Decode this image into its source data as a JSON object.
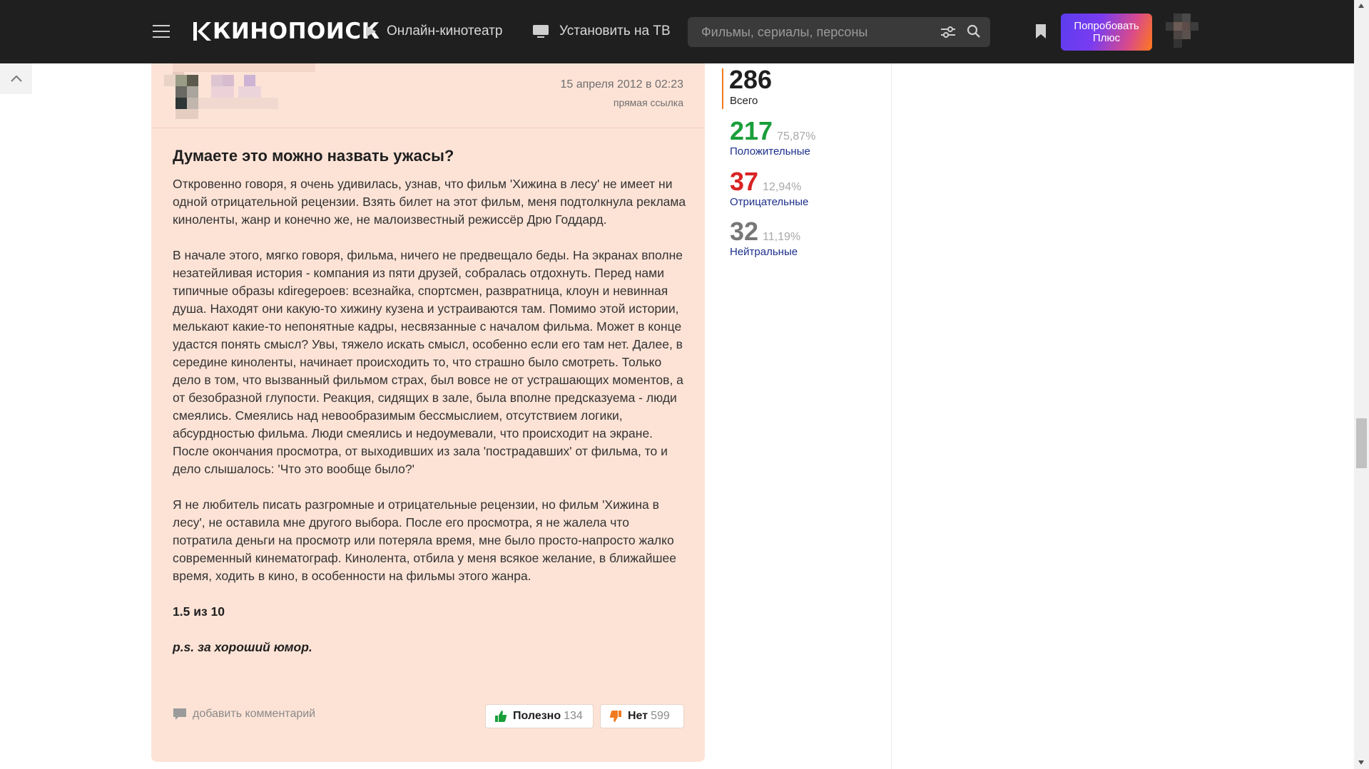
{
  "header": {
    "logo_text": "КИНОПОИСК",
    "nav": {
      "online_cinema": "Онлайн-кинотеатр",
      "install_tv": "Установить на ТВ"
    },
    "search": {
      "placeholder": "Фильмы, сериалы, персоны"
    },
    "plus_button": {
      "line1": "Попробовать",
      "line2": "Плюс"
    },
    "icons": [
      "menu-icon",
      "play-icon",
      "tv-icon",
      "filter-icon",
      "search-icon",
      "bookmark-icon"
    ]
  },
  "review": {
    "date": "15 апреля 2012 в 02:23",
    "permalink": "прямая ссылка",
    "title": "Думаете это можно назвать ужасы?",
    "paragraphs": [
      "Откровенно говоря, я очень удивилась, узнав, что фильм 'Хижина в лесу' не имеет ни одной отрицательной рецензии. Взять билет на этот фильм, меня подтолкнула реклама киноленты, жанр и конечно же, не малоизвестный режиссёр Дрю Годдард.",
      "В начале этого, мягко говоря, фильма, ничего не предвещало беды. На экранах вполне незатейливая история - компания из пяти друзей, собралась отдохнуть. Перед нами типичные образы кdiregероев: всезнайка, спортсмен, развратница, клоун и невинная душа. Находят они какую-то хижину кузена и устраиваются там. Помимо этой истории, мелькают какие-то непонятные кадры, несвязанные с началом фильма. Может в конце удастся понять смысл? Увы, тяжело искать смысл, особенно если его там нет. Далее, в середине киноленты, начинает происходить то, что страшно было смотреть. Только дело в том, что вызванный фильмом страх, был вовсе не от устрашающих моментов, а от безобразной глупости. Реакция, сидящих в зале, была вполне предсказуема - люди смеялись. Смеялись над невообразимым бессмыслием, отсутствием логики, абсурдностью фильма. Люди смеялись и недоумевали, что происходит на экране. После окончания просмотра, от выходивших из зала 'пострадавших' от фильма, то и дело слышалось: 'Что это вообще было?'",
      "Я не любитель писать разгромные и отрицательные рецензии, но фильм 'Хижина в лесу', не оставила мне другого выбора. После его просмотра, я не жалела что потратила деньги на просмотр или потеряла время, мне было просто-напросто жалко современный кинематограф. Кинолента, отбила у меня всякое желание, в ближайшее время, ходить в кино, в особенности на фильмы этого жанра."
    ],
    "score": "1.5 из 10",
    "ps": "p.s. за хороший юмор.",
    "add_comment": "добавить комментарий",
    "vote_yes": {
      "label": "Полезно",
      "count": "134"
    },
    "vote_no": {
      "label": "Нет",
      "count": "599"
    }
  },
  "stats": {
    "total": {
      "value": "286",
      "label": "Всего"
    },
    "positive": {
      "value": "217",
      "percent": "75,87%",
      "label": "Положительные"
    },
    "negative": {
      "value": "37",
      "percent": "12,94%",
      "label": "Отрицательные"
    },
    "neutral": {
      "value": "32",
      "percent": "11,19%",
      "label": "Нейтральные"
    }
  },
  "colors": {
    "header_bg": "#1f1f1f",
    "review_bg": "#fde3d6",
    "positive": "#1a9e3a",
    "negative": "#d92323",
    "neutral": "#777777",
    "accent": "#f07a21",
    "link": "#1c2f8c"
  }
}
